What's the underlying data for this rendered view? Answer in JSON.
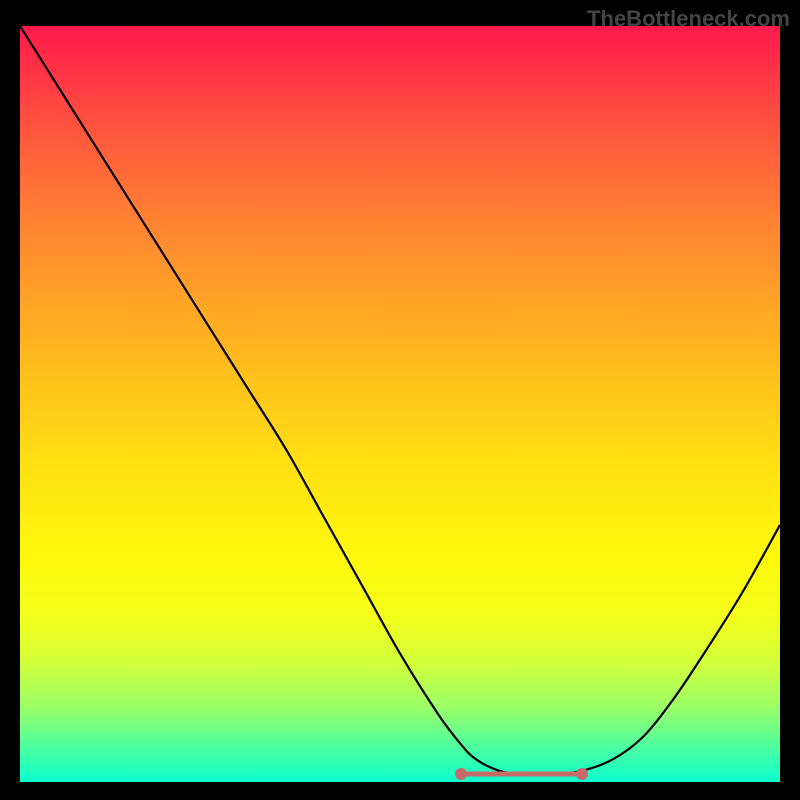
{
  "watermark": "TheBottleneck.com",
  "chart_data": {
    "type": "line",
    "title": "",
    "xlabel": "",
    "ylabel": "",
    "xlim": [
      0,
      100
    ],
    "ylim": [
      0,
      100
    ],
    "series": [
      {
        "name": "curve",
        "x": [
          0,
          5,
          10,
          15,
          20,
          25,
          30,
          35,
          40,
          45,
          50,
          55,
          58,
          60,
          63,
          66,
          70,
          74,
          78,
          82,
          86,
          90,
          95,
          100
        ],
        "y": [
          100,
          92,
          84,
          76,
          68,
          60,
          52,
          44,
          35,
          26,
          17,
          9,
          5,
          3,
          1.5,
          1,
          1,
          1.5,
          3,
          6,
          11,
          17,
          25,
          34
        ]
      }
    ],
    "highlight": {
      "x_start": 58,
      "x_end": 74,
      "y": 1
    },
    "gradient": [
      "#ff1a4d",
      "#ff8a30",
      "#ffe012",
      "#f4ff1a",
      "#52ff9c",
      "#0cffd0"
    ]
  }
}
